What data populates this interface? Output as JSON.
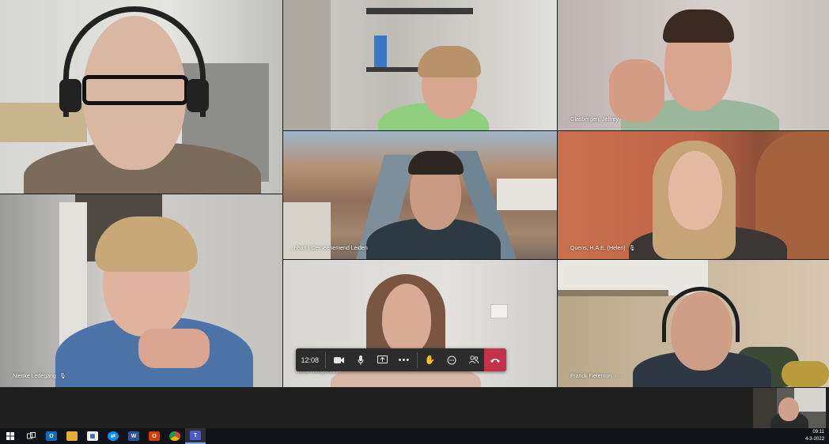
{
  "participants": [
    {
      "name": "",
      "muted": false
    },
    {
      "name": "",
      "muted": false
    },
    {
      "name": "Glasbergen, Jeffrey",
      "muted": false
    },
    {
      "name": "",
      "muted": false
    },
    {
      "name": "...nhart | Gemeenemend Leiden",
      "muted": false
    },
    {
      "name": "Quens, H.A.E. (Helen)",
      "muted": true
    },
    {
      "name": "Nienke Ledegang",
      "muted": true
    },
    {
      "name": "Sarah Weggelaar",
      "muted": false
    },
    {
      "name": "Franck Fielemon",
      "muted": false,
      "more": "···"
    }
  ],
  "controls": {
    "timer": "12:08",
    "camera_icon": "camera-icon",
    "mic_icon": "microphone-icon",
    "share_icon": "share-screen-icon",
    "more_icon": "more-icon",
    "raise_hand_icon": "raise-hand-icon",
    "chat_icon": "chat-icon",
    "participants_icon": "participants-icon",
    "hangup_icon": "hang-up-icon",
    "hangup_color": "#c4314b"
  },
  "taskbar": {
    "time": "09:11",
    "date": "4-3-2022",
    "apps": [
      "start-icon",
      "task-view-icon",
      "outlook-icon",
      "file-explorer-icon",
      "calendar-icon",
      "teamviewer-icon",
      "word-icon",
      "office-icon",
      "chrome-icon",
      "teams-icon"
    ]
  },
  "colors": {
    "stage": "#1b1b1b",
    "taskbar": "#101418",
    "accent": "#7da7e8"
  }
}
